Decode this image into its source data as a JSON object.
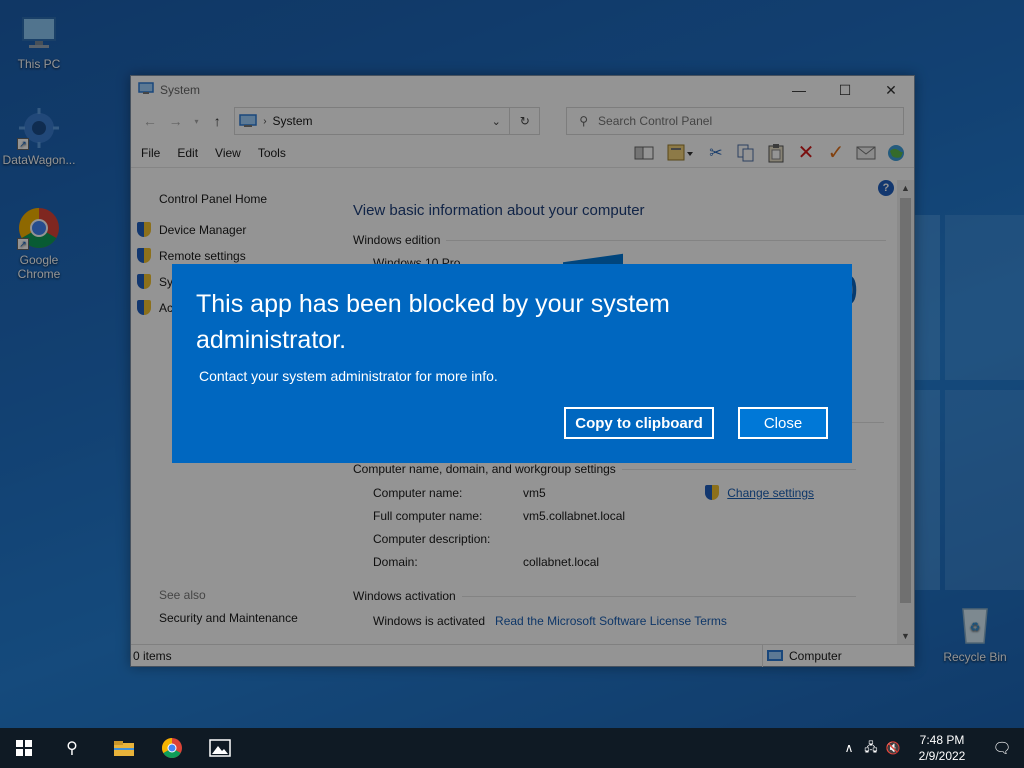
{
  "desktop": {
    "icons": [
      {
        "label": "This PC"
      },
      {
        "label": "DataWagon..."
      },
      {
        "label": "Google Chrome"
      },
      {
        "label": "Recycle Bin"
      }
    ]
  },
  "window": {
    "title": "System",
    "address": {
      "crumb": "System"
    },
    "search": {
      "placeholder": "Search Control Panel"
    },
    "menu": {
      "file": "File",
      "edit": "Edit",
      "view": "View",
      "tools": "Tools"
    },
    "left": {
      "home": "Control Panel Home",
      "tasks": [
        "Device Manager",
        "Remote settings",
        "Sy",
        "Ac"
      ],
      "see_also": "See also",
      "security": "Security and Maintenance"
    },
    "main": {
      "heading": "View basic information about your computer",
      "windows_edition": {
        "title": "Windows edition",
        "value": "Windows 10 Pro",
        "bignum": "0"
      },
      "computer": {
        "title": "Computer name, domain, and workgroup settings",
        "change": "Change settings",
        "rows": [
          {
            "k": "Computer name:",
            "v": "vm5"
          },
          {
            "k": "Full computer name:",
            "v": "vm5.collabnet.local"
          },
          {
            "k": "Computer description:",
            "v": ""
          },
          {
            "k": "Domain:",
            "v": "collabnet.local"
          }
        ]
      },
      "activation": {
        "title": "Windows activation",
        "status": "Windows is activated",
        "link": "Read the Microsoft Software License Terms"
      }
    },
    "status": {
      "items": "0 items",
      "location": "Computer"
    }
  },
  "dialog": {
    "title": "This app has been blocked by your system administrator.",
    "message": "Contact your system administrator for more info.",
    "copy_label": "Copy to clipboard",
    "close_label": "Close"
  },
  "taskbar": {
    "time": "7:48 PM",
    "date": "2/9/2022"
  }
}
